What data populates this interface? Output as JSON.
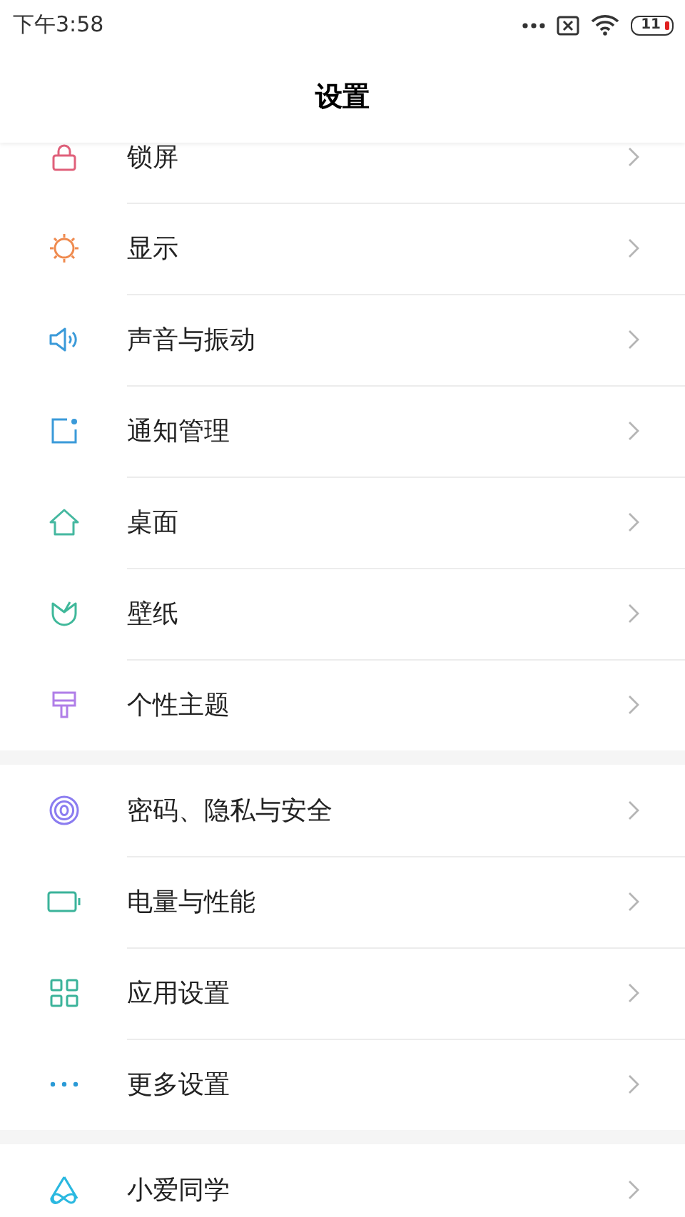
{
  "status_bar": {
    "time": "下午3:58",
    "battery": "11"
  },
  "header": {
    "title": "设置"
  },
  "groups": [
    {
      "items": [
        {
          "label": "锁屏"
        },
        {
          "label": "显示"
        },
        {
          "label": "声音与振动"
        },
        {
          "label": "通知管理"
        },
        {
          "label": "桌面"
        },
        {
          "label": "壁纸"
        },
        {
          "label": "个性主题"
        }
      ]
    },
    {
      "items": [
        {
          "label": "密码、隐私与安全"
        },
        {
          "label": "电量与性能"
        },
        {
          "label": "应用设置"
        },
        {
          "label": "更多设置"
        }
      ]
    },
    {
      "items": [
        {
          "label": "小爱同学"
        }
      ]
    }
  ]
}
